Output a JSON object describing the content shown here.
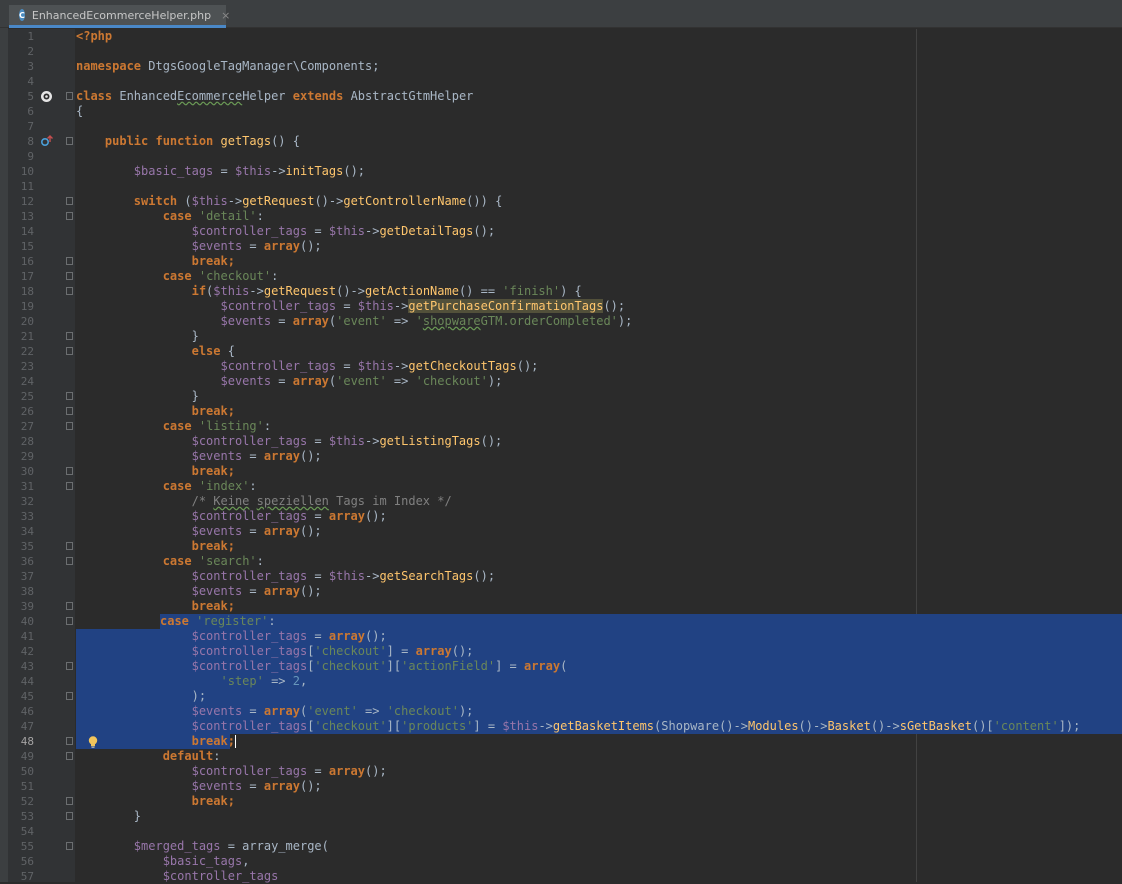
{
  "tab": {
    "icon": "php-class-icon",
    "icon_letter": "C",
    "title": "EnhancedEcommerceHelper.php",
    "close": "×"
  },
  "line_numbers": [
    "1",
    "2",
    "3",
    "4",
    "5",
    "6",
    "7",
    "8",
    "9",
    "10",
    "11",
    "12",
    "13",
    "14",
    "15",
    "16",
    "17",
    "18",
    "19",
    "20",
    "21",
    "22",
    "23",
    "24",
    "25",
    "26",
    "27",
    "28",
    "29",
    "30",
    "31",
    "32",
    "33",
    "34",
    "35",
    "36",
    "37",
    "38",
    "39",
    "40",
    "41",
    "42",
    "43",
    "44",
    "45",
    "46",
    "47",
    "48",
    "49",
    "50",
    "51",
    "52",
    "53",
    "54",
    "55",
    "56",
    "57"
  ],
  "current_line": "48",
  "code": {
    "l1_open_tag": "<?php",
    "l3_kw": "namespace",
    "l3_ns": " DtgsGoogleTagManager\\Components;",
    "l5_kw_class": "class",
    "l5_name_a": " Enhanced",
    "l5_name_b": "Ecommerce",
    "l5_name_c": "Helper ",
    "l5_kw_extends": "extends",
    "l5_parent": " AbstractGtmHelper",
    "l6": "{",
    "l8_kw": "public function",
    "l8_fn": " getTags",
    "l8_rest": "() {",
    "l10_var": "$basic_tags",
    "l10_eq": " = ",
    "l10_this": "$this",
    "l10_arrow": "->",
    "l10_fn": "initTags",
    "l10_end": "();",
    "l12_kw": "switch",
    "l12_a": " (",
    "l12_this": "$this",
    "l12_b": "->",
    "l12_fn1": "getRequest",
    "l12_c": "()->",
    "l12_fn2": "getControllerName",
    "l12_d": "()) {",
    "case": "case",
    "break": "break",
    "semi": ";",
    "colon": ":",
    "array": "array",
    "arr_end": "();",
    "ctrl_var": "$controller_tags",
    "events_var": "$events",
    "this": "$this",
    "eq": " = ",
    "arrow": "->",
    "call_end": "();",
    "s_detail": "'detail'",
    "fn_detail": "getDetailTags",
    "s_checkout": "'checkout'",
    "l18_if": "if",
    "l18_a": "(",
    "l18_fn1": "getRequest",
    "l18_b": "()->",
    "l18_fn2": "getActionName",
    "l18_c": "() == ",
    "l18_s": "'finish'",
    "l18_d": ") {",
    "fn_purchase": "getPurchaseConfirmationTags",
    "l20_open": "(",
    "s_event": "'event'",
    "fat_arrow": " => ",
    "l20_s_a": "'",
    "l20_s_b": "shopware",
    "l20_s_c": "GTM.orderCompleted'",
    "paren_semi": ");",
    "close_brace": "}",
    "kw_else": "else",
    "open_brace_sp": " {",
    "fn_checkout": "getCheckoutTags",
    "s_checkout_val": "'checkout'",
    "s_listing": "'listing'",
    "fn_listing": "getListingTags",
    "s_index": "'index'",
    "l32_a": "/* ",
    "l32_b": "Keine",
    "l32_c": " ",
    "l32_d": "speziellen",
    "l32_e": " Tags im Index */",
    "s_search": "'search'",
    "fn_search": "getSearchTags",
    "s_register": "'register'",
    "l42_idx": "[",
    "l42_idx_end": "]",
    "s_actionField": "'actionField'",
    "l43_tail": "(",
    "s_step": "'step'",
    "n_two": "2",
    "comma": ",",
    "s_products": "'products'",
    "fn_basket": "getBasketItems",
    "l47_a": "(Shopware()->",
    "fn_modules": "Modules",
    "l47_b": "()->",
    "fn_basket_mod": "Basket",
    "l47_c": "()->",
    "fn_sget": "sGetBasket",
    "l47_d": "()[",
    "s_content": "'content'",
    "l47_e": "]);",
    "kw_default": "default",
    "l55_var": "$merged_tags",
    "l55_fn": " = array_merge(",
    "l56_var": "$basic_tags",
    "l57_var": "$controller_tags"
  },
  "gutter_icons": {
    "line5": "override-icon",
    "line8": "implements-icon",
    "line48": "intention-bulb-icon"
  }
}
